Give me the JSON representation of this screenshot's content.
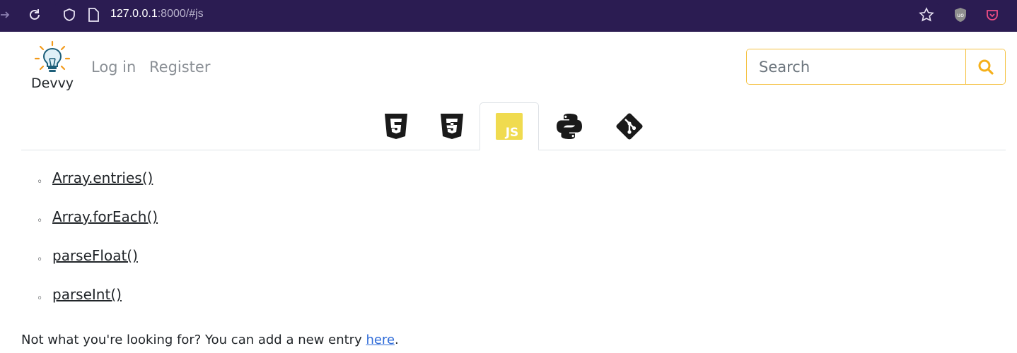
{
  "browser": {
    "url_host": "127.0.0.1",
    "url_rest": ":8000/#js"
  },
  "header": {
    "logo_text": "Devvy",
    "nav": [
      {
        "label": "Log in"
      },
      {
        "label": "Register"
      }
    ],
    "search": {
      "placeholder": "Search",
      "value": ""
    }
  },
  "tabs": [
    {
      "name": "html5-icon",
      "active": false
    },
    {
      "name": "css3-icon",
      "active": false
    },
    {
      "name": "js-icon",
      "label": "JS",
      "active": true
    },
    {
      "name": "python-icon",
      "active": false
    },
    {
      "name": "git-icon",
      "active": false
    }
  ],
  "entries": [
    {
      "bullet": "◦",
      "label": "Array.entries()"
    },
    {
      "bullet": "◦",
      "label": "Array.forEach()"
    },
    {
      "bullet": "◦",
      "label": "parseFloat()"
    },
    {
      "bullet": "◦",
      "label": "parseInt()"
    }
  ],
  "footer": {
    "text": "Not what you're looking for? You can add a new entry ",
    "link_label": "here",
    "end": "."
  },
  "colors": {
    "browser_bg": "#2b1c52",
    "accent": "#f5c242",
    "js_yellow": "#f0db4f",
    "link_blue": "#2e6bd8"
  }
}
